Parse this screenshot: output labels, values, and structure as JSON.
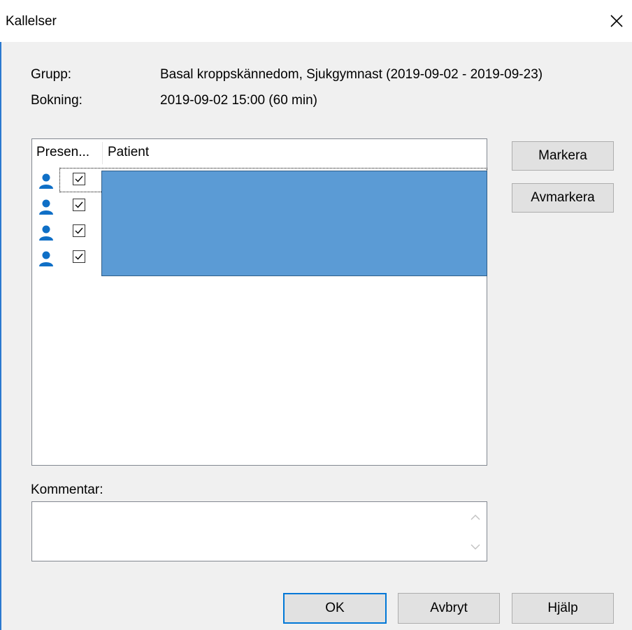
{
  "window": {
    "title": "Kallelser",
    "close_icon": "close-icon"
  },
  "info": {
    "group_label": "Grupp:",
    "group_value": "Basal kroppskännedom, Sjukgymnast (2019-09-02 - 2019-09-23)",
    "booking_label": "Bokning:",
    "booking_value": "2019-09-02 15:00 (60 min)"
  },
  "list": {
    "columns": [
      "Presen...",
      "Patient"
    ],
    "rows": [
      {
        "icon": "person-icon",
        "checked": true
      },
      {
        "icon": "person-icon",
        "checked": true
      },
      {
        "icon": "person-icon",
        "checked": true
      },
      {
        "icon": "person-icon",
        "checked": true
      }
    ]
  },
  "side_buttons": {
    "select": "Markera",
    "deselect": "Avmarkera"
  },
  "comment": {
    "label": "Kommentar:",
    "value": ""
  },
  "footer_buttons": {
    "ok": "OK",
    "cancel": "Avbryt",
    "help": "Hjälp"
  },
  "colors": {
    "accent": "#0078d7",
    "selection": "#5b9bd5",
    "person_icon": "#0f6fc6"
  }
}
